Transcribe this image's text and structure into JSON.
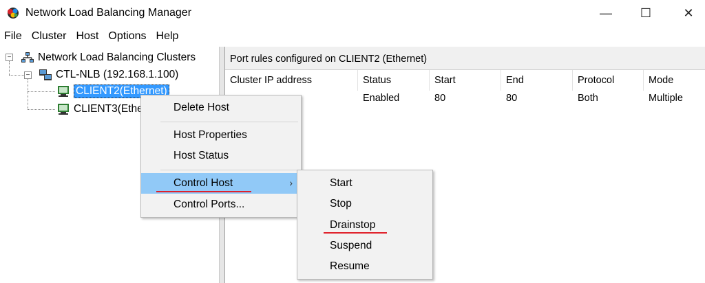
{
  "window": {
    "title": "Network Load Balancing Manager",
    "minimize_glyph": "—",
    "maximize_glyph": "☐",
    "close_glyph": "✕"
  },
  "menubar": [
    "File",
    "Cluster",
    "Host",
    "Options",
    "Help"
  ],
  "tree": {
    "root": "Network Load Balancing Clusters",
    "cluster": "CTL-NLB (192.168.1.100)",
    "hosts": [
      "CLIENT2(Ethernet)",
      "CLIENT3(Ethernet)"
    ],
    "expander_glyph": "−"
  },
  "right_pane": {
    "header": "Port rules configured on CLIENT2 (Ethernet)",
    "columns": [
      "Cluster IP address",
      "Status",
      "Start",
      "End",
      "Protocol",
      "Mode"
    ],
    "rows": [
      [
        "",
        "Enabled",
        "80",
        "80",
        "Both",
        "Multiple"
      ]
    ]
  },
  "context_menu": {
    "items": [
      "Delete Host",
      "Host Properties",
      "Host Status",
      "Control Host",
      "Control Ports..."
    ],
    "submenu_arrow": "›",
    "highlighted": "Control Host"
  },
  "submenu": {
    "items": [
      "Start",
      "Stop",
      "Drainstop",
      "Suspend",
      "Resume"
    ]
  },
  "colors": {
    "selection": "#3399ff",
    "menu_highlight": "#91c9f7",
    "annotation_underline": "#e0202a"
  }
}
